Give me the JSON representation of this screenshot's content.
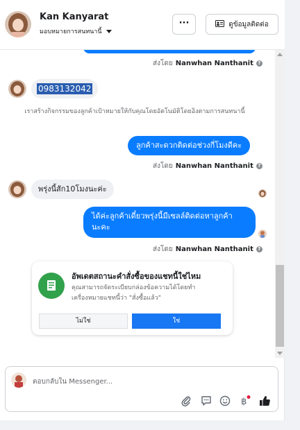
{
  "header": {
    "name": "Kan Kanyarat",
    "assign_label": "มอบหมายการสนทนานี้",
    "more_label": "···",
    "contact_label": "ดูข้อมูลติดต่อ"
  },
  "messages": {
    "sent_by_prefix": "ส่งโดย",
    "sender_name": "Nanwhan Nanthanit",
    "phone": "0983132042",
    "system_note": "เราสร้างกิจกรรมของลูกค้าเป้าหมายให้กับคุณโดยอัตโนมัติโดยอิงตามการสนทนานี้",
    "out_1": "ลูกค้าสะดวกติดต่อช่วงกี่โมงดีคะ",
    "in_1": "พรุ่งนี้สัก10โมงนะค่ะ",
    "out_2_line1": "ได้ค่ะลูกค้าเดี๋ยวพรุ่งนี้มีเซลล์ติดต่อหาลูกค้า",
    "out_2_line2": "นะคะ"
  },
  "order_card": {
    "title": "อัพเดตสถานะคำสั่งซื้อของแชทนี้ใช่ไหม",
    "desc_line1": "คุณสามารถจัดระเบียบกล่องข้อความได้โดยทำ",
    "desc_line2": "เครื่องหมายแชทนี้ว่า \"สั่งซื้อแล้ว\"",
    "no_label": "ไม่ใช่",
    "yes_label": "ใช่"
  },
  "composer": {
    "placeholder": "ตอบกลับใน Messenger..."
  },
  "icons": [
    "more-options-icon",
    "contact-card-icon",
    "info-icon",
    "order-icon",
    "attachment-icon",
    "saved-reply-icon",
    "emoji-icon",
    "currency-baht-icon",
    "like-icon"
  ],
  "colors": {
    "accent": "#0a7cff",
    "button_primary": "#1877f2",
    "order_icon_bg": "#31a24c",
    "notification_dot": "#e41e3f"
  }
}
